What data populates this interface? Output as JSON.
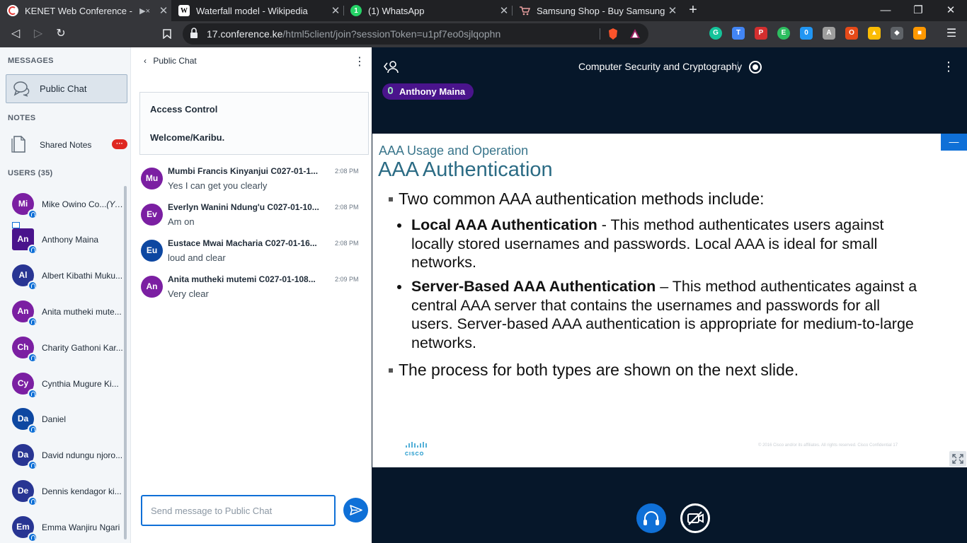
{
  "browser": {
    "tabs": [
      {
        "title": "KENET Web Conference - Com",
        "icon": "kenet-favicon",
        "muted": true,
        "active": true
      },
      {
        "title": "Waterfall model - Wikipedia",
        "icon": "wikipedia-favicon"
      },
      {
        "title": "(1) WhatsApp",
        "icon": "whatsapp-favicon"
      },
      {
        "title": "Samsung Shop - Buy Samsung Ele",
        "icon": "samsung-cart-favicon"
      }
    ],
    "url_host": "17.conference.ke",
    "url_path": "/html5client/join?sessionToken=u1pf7eo0sjlqophn"
  },
  "sidebar": {
    "messages_title": "MESSAGES",
    "public_chat_label": "Public Chat",
    "notes_title": "NOTES",
    "shared_notes_label": "Shared Notes",
    "shared_notes_badge": "···",
    "users_title": "USERS (35)",
    "users": [
      {
        "initials": "Mi",
        "name": "Mike Owino Co...",
        "you": "(You)",
        "color": "#7b1fa2"
      },
      {
        "initials": "An",
        "name": "Anthony Maina",
        "color": "#4a148c",
        "presenter": true
      },
      {
        "initials": "Al",
        "name": "Albert Kibathi Muku...",
        "color": "#283593"
      },
      {
        "initials": "An",
        "name": "Anita mutheki mute...",
        "color": "#7b1fa2"
      },
      {
        "initials": "Ch",
        "name": "Charity Gathoni Kar...",
        "color": "#7b1fa2"
      },
      {
        "initials": "Cy",
        "name": "Cynthia Mugure Ki...",
        "color": "#7b1fa2"
      },
      {
        "initials": "Da",
        "name": "Daniel",
        "color": "#0d47a1"
      },
      {
        "initials": "Da",
        "name": "David ndungu njoro...",
        "color": "#283593"
      },
      {
        "initials": "De",
        "name": "Dennis kendagor ki...",
        "color": "#283593"
      },
      {
        "initials": "Em",
        "name": "Emma Wanjiru Ngari",
        "color": "#283593"
      }
    ]
  },
  "chat": {
    "title": "Public Chat",
    "welcome_title": "Access Control",
    "welcome_text": "Welcome/Karibu.",
    "messages": [
      {
        "initials": "Mu",
        "author": "Mumbi Francis Kinyanjui C027-01-1...",
        "time": "2:08 PM",
        "text": "Yes I can get you clearly",
        "color": "#7b1fa2"
      },
      {
        "initials": "Ev",
        "author": "Everlyn Wanini Ndung'u C027-01-10...",
        "time": "2:08 PM",
        "text": "Am on",
        "color": "#7b1fa2"
      },
      {
        "initials": "Eu",
        "author": "Eustace Mwai Macharia C027-01-16...",
        "time": "2:08 PM",
        "text": "loud and clear",
        "color": "#0d47a1"
      },
      {
        "initials": "An",
        "author": "Anita mutheki mutemi C027-01-108...",
        "time": "2:09 PM",
        "text": "Very clear",
        "color": "#7b1fa2"
      }
    ],
    "input_placeholder": "Send message to Public Chat"
  },
  "presentation": {
    "meeting_title": "Computer Security and Cryptography",
    "talking_user": "Anthony Maina",
    "slide": {
      "subtitle": "AAA Usage and Operation",
      "heading": "AAA Authentication",
      "bullet1": "Two common AAA authentication methods include:",
      "local_bold": "Local AAA Authentication",
      "local_line1": " - This method authenticates users against",
      "local_line2": "locally stored usernames and passwords. Local AAA is ideal for small",
      "local_line3": "networks.",
      "server_bold": "Server-Based AAA Authentication",
      "server_line1": " – This method authenticates against a",
      "server_line2": "central AAA server that contains the usernames and passwords for all",
      "server_line3": "users. Server-based AAA authentication is appropriate for medium-to-large",
      "server_line4": "networks.",
      "bullet2": "The process for both types are shown on the next slide.",
      "logo_text": "CISCO",
      "footer": "© 2016  Cisco and/or its affiliates. All rights reserved.   Cisco Confidential        17"
    }
  },
  "colors": {
    "accent": "#0f70d7",
    "stage_bg": "#06172a",
    "presenter": "#4a148c"
  }
}
